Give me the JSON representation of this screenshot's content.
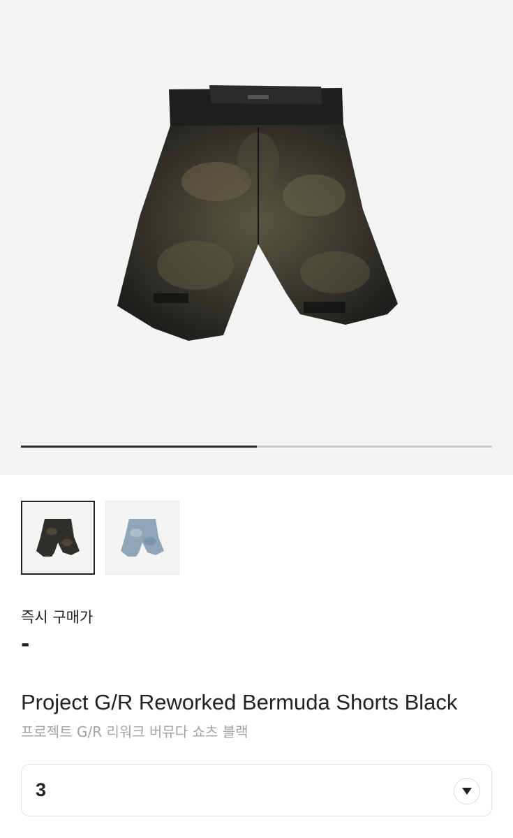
{
  "gallery": {
    "images": [
      {
        "name": "black-bermuda-shorts",
        "color": "#2e2c28"
      },
      {
        "name": "light-blue-bermuda-shorts",
        "color": "#8fa6b8"
      }
    ],
    "selected_index": 0,
    "progress_fraction": 0.5
  },
  "price": {
    "label": "즉시 구매가",
    "value": "-"
  },
  "product": {
    "title_en": "Project G/R Reworked Bermuda Shorts Black",
    "title_ko": "프로젝트 G/R 리워크 버뮤다 쇼츠 블랙"
  },
  "size_selector": {
    "selected_value": "3",
    "icon": "chevron-down-icon"
  },
  "colors": {
    "hero_bg": "#f4f4f4",
    "text_primary": "#222222",
    "text_secondary": "#a3a3a3",
    "progress_active": "#2b2b2b",
    "progress_track": "#c9c9c9"
  }
}
